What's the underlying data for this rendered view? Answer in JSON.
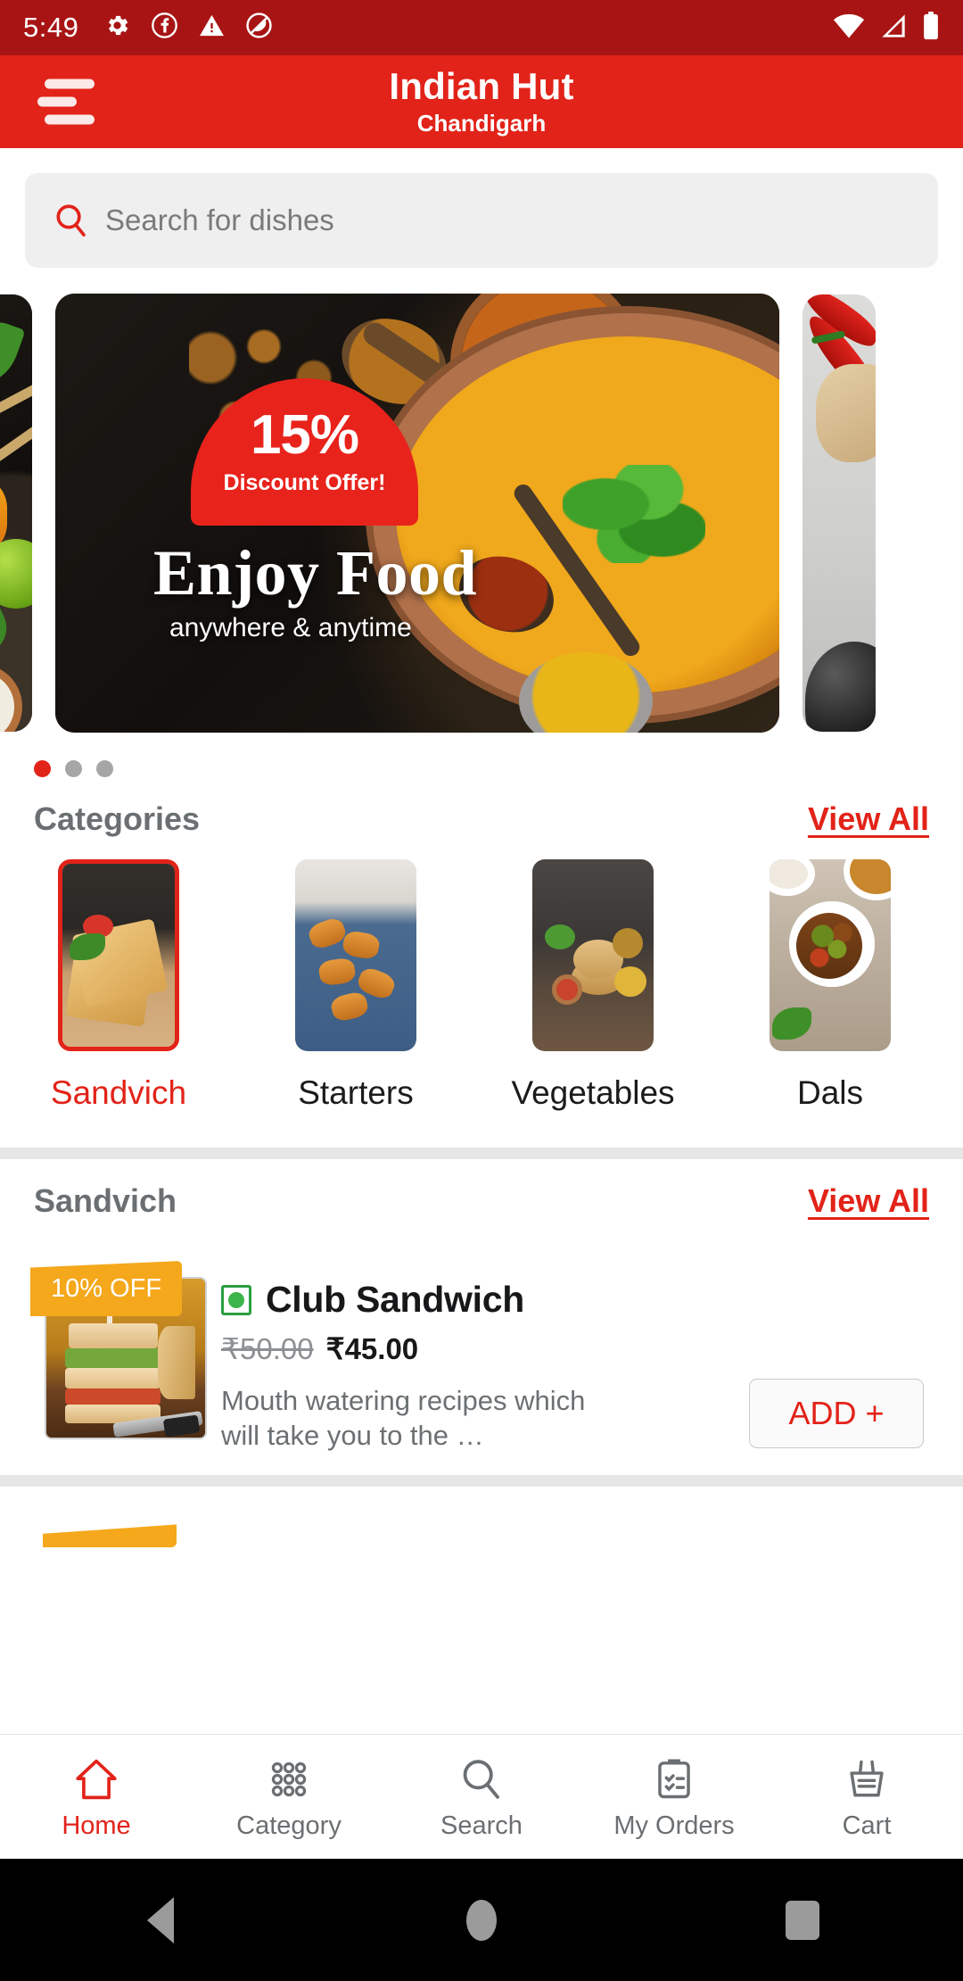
{
  "status_bar": {
    "time": "5:49",
    "left_icons": [
      "gear-icon",
      "facebook-icon",
      "warning-icon",
      "do-not-disturb-icon"
    ],
    "right_icons": [
      "wifi-icon",
      "signal-icon",
      "battery-icon"
    ],
    "background": "#a81414"
  },
  "app_bar": {
    "menu_icon": "hamburger-menu-icon",
    "title": "Indian Hut",
    "subtitle": "Chandigarh",
    "background": "#e22319"
  },
  "search": {
    "placeholder": "Search for dishes",
    "icon": "search-icon"
  },
  "carousel": {
    "slides": [
      {
        "id": "slide-prev",
        "kind": "partial-left"
      },
      {
        "id": "slide-current",
        "kind": "main",
        "badge_percent": "15%",
        "badge_text": "Discount Offer!",
        "headline": "Enjoy Food",
        "subline": "anywhere & anytime"
      },
      {
        "id": "slide-next",
        "kind": "partial-right"
      }
    ],
    "dots": [
      {
        "active": true
      },
      {
        "active": false
      },
      {
        "active": false
      }
    ],
    "active_dot_color": "#e22319",
    "inactive_dot_color": "#a6a6a6"
  },
  "categories_section": {
    "title": "Categories",
    "view_all": "View All",
    "items": [
      {
        "label": "Sandvich",
        "art": "ct-sandvich",
        "selected": true
      },
      {
        "label": "Starters",
        "art": "ct-starters",
        "selected": false
      },
      {
        "label": "Vegetables",
        "art": "ct-veg",
        "selected": false
      },
      {
        "label": "Dals",
        "art": "ct-dals",
        "selected": false
      }
    ]
  },
  "products_section": {
    "title": "Sandvich",
    "view_all": "View All",
    "items": [
      {
        "discount_badge": "10% OFF",
        "veg_indicator": "veg-mark-icon",
        "name": "Club Sandwich",
        "old_price": "₹50.00",
        "new_price": "₹45.00",
        "description": "Mouth watering recipes which will take you to the …",
        "add_label": "ADD +"
      }
    ]
  },
  "bottom_nav": {
    "items": [
      {
        "label": "Home",
        "icon": "home-icon",
        "active": true
      },
      {
        "label": "Category",
        "icon": "grid-dots-icon",
        "active": false
      },
      {
        "label": "Search",
        "icon": "search-icon",
        "active": false
      },
      {
        "label": "My Orders",
        "icon": "clipboard-check-icon",
        "active": false
      },
      {
        "label": "Cart",
        "icon": "basket-icon",
        "active": false
      }
    ],
    "active_color": "#e22319",
    "inactive_color": "#6b6f72"
  },
  "android_nav": {
    "buttons": [
      "back-button",
      "home-button",
      "recents-button"
    ]
  }
}
